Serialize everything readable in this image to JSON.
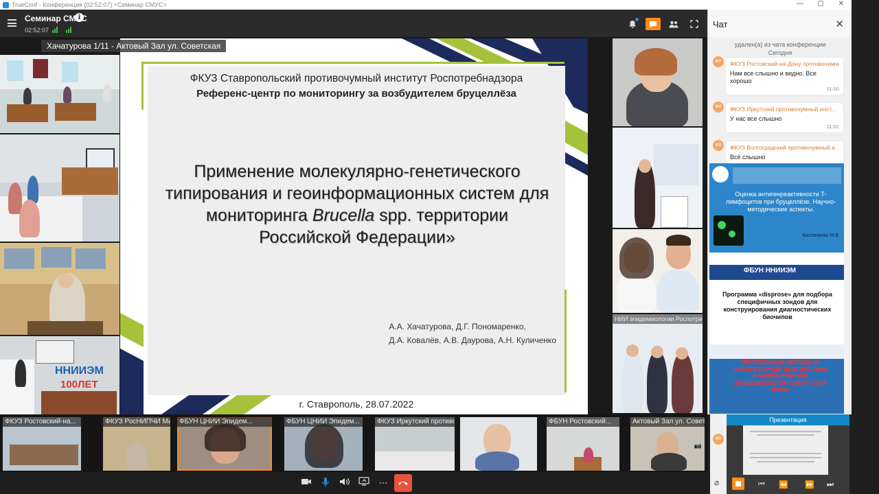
{
  "os_title": "TrueConf - Конференция (02:52:07) <Семинар СМУС>",
  "os_controls": [
    "—",
    "▢",
    "✕"
  ],
  "conference": {
    "title": "Семинар СМУС",
    "elapsed": "02:52:07"
  },
  "presenter_label": "Хачатурова 1/11 - Актовый Зал ул. Советская",
  "slide": {
    "org_line1": "ФКУЗ Ставропольский противочумный институт Роспотребнадзора",
    "org_line2": "Референс-центр по мониторингу за возбудителем бруцеллёза",
    "title_part1": "Применение молекулярно-генетического типирования и геоинформационных систем для мониторинга ",
    "title_italic": "Brucella",
    "title_part2": " spp. территории Российской Федерации»",
    "authors_line1": "А.А. Хачатурова, Д.Г. Пономаренко,",
    "authors_line2": "Д.А. Ковалёв, А.В. Даурова, А.Н. Куличенко",
    "city": "г. Ставрополь, 28.07.2022"
  },
  "right_tile_label": "НИИ эпидемиологии Роспотребнадзора",
  "chat": {
    "title": "Чат",
    "sys_top": "удален(а) из чата конференции",
    "date_label": "Сегодня",
    "messages": [
      {
        "avatar": "ФР",
        "sender": "ФКУЗ Ростовский-на-Дону противочумный",
        "text": "Нам все слышно и видно. Все хорошо",
        "time": "11:00"
      },
      {
        "avatar": "ФИ",
        "sender": "ФКУЗ Иркутский противочумный инст...",
        "text": "У нас все слышно",
        "time": "11:01"
      },
      {
        "avatar": "ФВ",
        "sender": "ФКУЗ Волгоградский противочумный и...",
        "text": "Всё слышно",
        "time": ""
      }
    ]
  },
  "thumbs": {
    "t1_title": "Оценка антигенреактивности Т-лимфоцитов при бруцеллёзе. Научно-методические аспекты.",
    "t1_author": "Костюченко М.В.",
    "t2_org": "ФБУН ННИИЭМ",
    "t2_title": "Программа «disprose» для подбора специфичных зондов для конструирования диагностических биочипов",
    "t3_title": "ПРОТЕОМНЫЕ МЕТОДЫ В ЛАБОРАТОРНОЙ ДИАГНОСТИКЕ И МОЛЕКУЛЯРНОЙ ЭПИДЕМИОЛОГИИ СИБИРСКОЙ ЯЗВЫ"
  },
  "strip_tiles": [
    {
      "label": "ФКУЗ Ростовский-на..."
    },
    {
      "label": "ФКУЗ РосНИПЧИ Микроб"
    },
    {
      "label": "ФБУН ЦНИИ Эпидем..."
    },
    {
      "label": "ФБУН ЦНИИ Эпидем..."
    },
    {
      "label": "ФКУЗ Иркутский противочумный институт Роспотребнадзора"
    },
    {
      "label": "ФБУН Ростовский..."
    },
    {
      "label": "Актовый Зал ул. Советс..."
    }
  ],
  "presentation_panel": {
    "title": "Презентация"
  },
  "colors": {
    "accent": "#ff8c1a",
    "slide_green": "#a5c23a",
    "slide_navy": "#1d2a5c",
    "chat_sender": "#e07a2e",
    "hangup": "#e8533c"
  }
}
